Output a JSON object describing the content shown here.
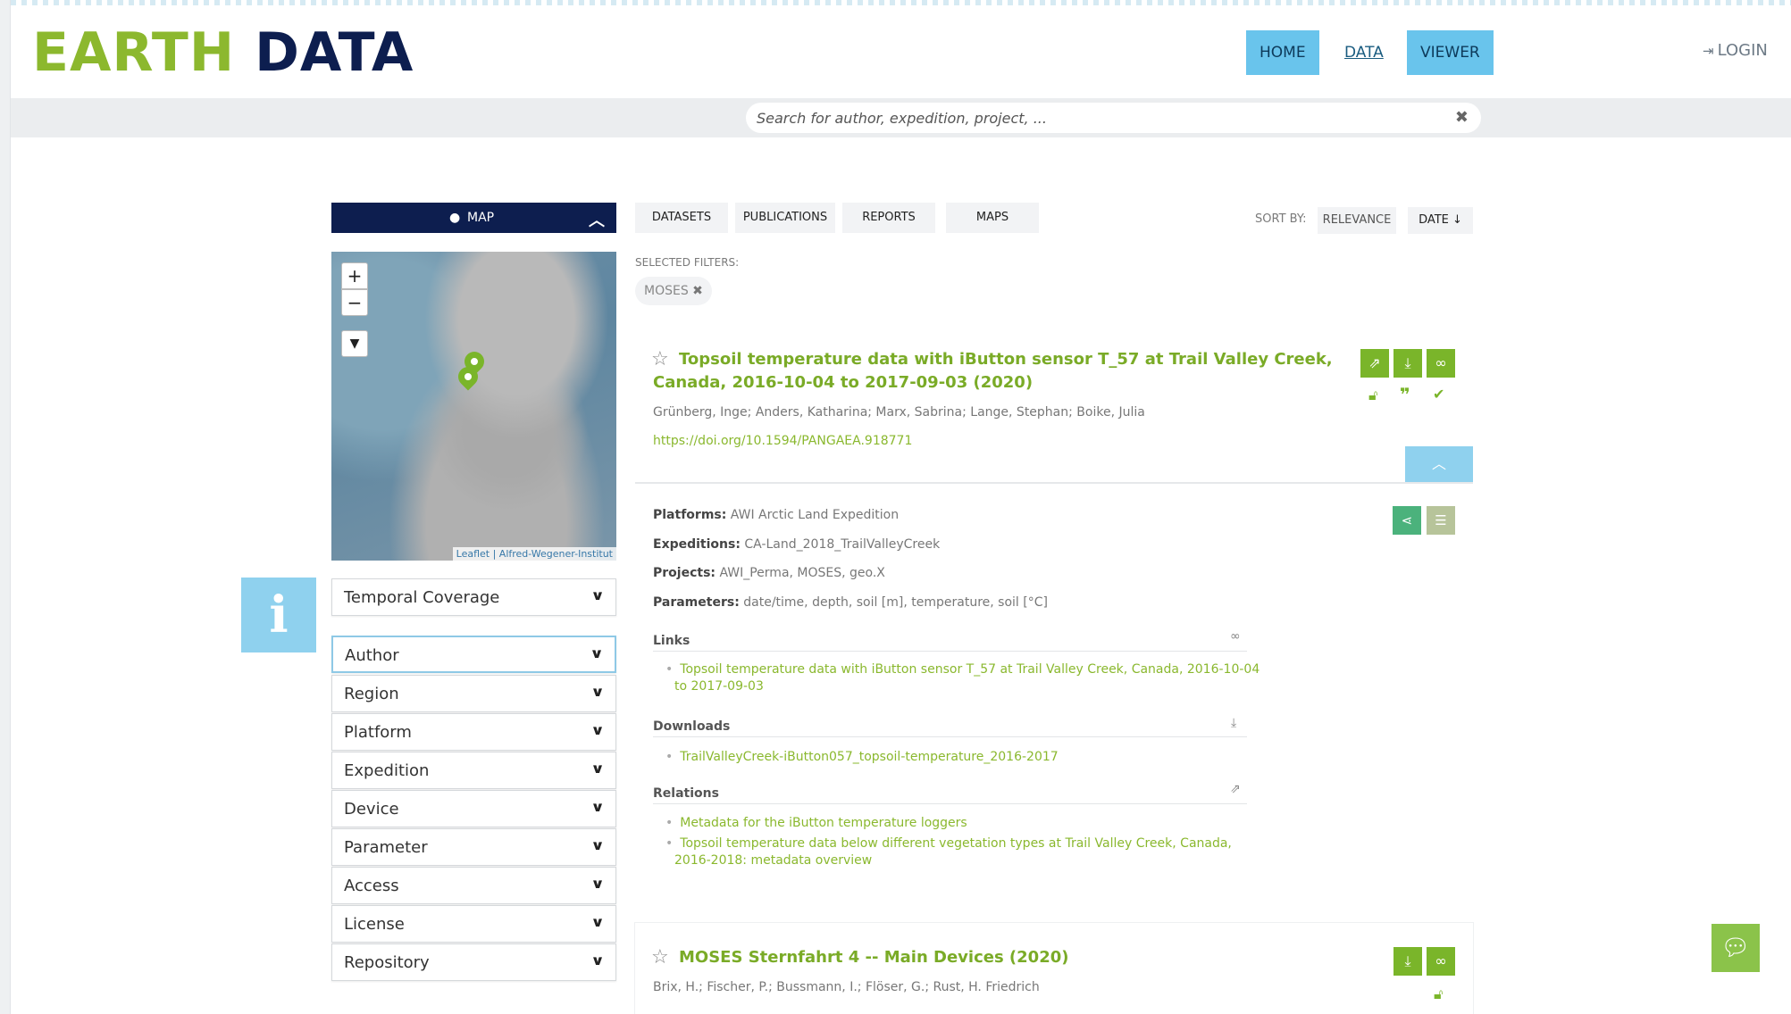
{
  "header": {
    "logo_part1": "EARTH",
    "logo_part2": "DATA",
    "nav": {
      "home": "HOME",
      "data": "DATA",
      "viewer": "VIEWER"
    },
    "login": "LOGIN"
  },
  "search": {
    "placeholder": "Search for author, expedition, project, ..."
  },
  "map_panel": {
    "title": "MAP",
    "attribution": "Leaflet | Alfred-Wegener-Institut"
  },
  "info_box": "i",
  "filters": [
    "Temporal Coverage",
    "Author",
    "Region",
    "Platform",
    "Expedition",
    "Device",
    "Parameter",
    "Access",
    "License",
    "Repository"
  ],
  "tabs": [
    "DATASETS",
    "PUBLICATIONS",
    "REPORTS",
    "MAPS"
  ],
  "sort": {
    "label": "SORT BY:",
    "relevance": "RELEVANCE",
    "date": "DATE"
  },
  "selected_filters": {
    "label": "SELECTED FILTERS:",
    "chips": [
      "MOSES"
    ]
  },
  "results": [
    {
      "title_line1": "Topsoil temperature data with iButton sensor T_57 at Trail Valley Creek,",
      "title_line2": "Canada, 2016-10-04 to 2017-09-03 (2020)",
      "authors": "Grünberg, Inge; Anders, Katharina; Marx, Sabrina; Lange, Stephan; Boike, Julia",
      "doi": "https://doi.org/10.1594/PANGAEA.918771",
      "platforms_label": "Platforms:",
      "platforms": "AWI Arctic Land Expedition",
      "expeditions_label": "Expeditions:",
      "expeditions": "CA-Land_2018_TrailValleyCreek",
      "projects_label": "Projects:",
      "projects": "AWI_Perma, MOSES, geo.X",
      "parameters_label": "Parameters:",
      "parameters": "date/time, depth, soil [m], temperature, soil [°C]",
      "links_header": "Links",
      "links": [
        "Topsoil temperature data with iButton sensor T_57 at Trail Valley Creek, Canada, 2016-10-04",
        "to 2017-09-03"
      ],
      "downloads_header": "Downloads",
      "downloads": [
        "TrailValleyCreek-iButton057_topsoil-temperature_2016-2017"
      ],
      "relations_header": "Relations",
      "relations": [
        "Metadata for the iButton temperature loggers",
        "Topsoil temperature data below different vegetation types at Trail Valley Creek, Canada,",
        "2016-2018: metadata overview"
      ]
    },
    {
      "title": "MOSES Sternfahrt 4 -- Main Devices (2020)",
      "authors": "Brix, H.; Fischer, P.; Bussmann, I.; Flöser, G.; Rust, H. Friedrich"
    }
  ],
  "colors": {
    "brand_green": "#8cb82e",
    "brand_navy": "#0d1e4f",
    "accent_blue": "#69c4ec",
    "action_green": "#7ab52a"
  },
  "icons": {
    "map_pin": "map-pin-icon",
    "chevron_up": "chevron-up-icon",
    "zoom_in": "plus-icon",
    "zoom_out": "minus-icon",
    "filter": "filter-icon",
    "external_link": "external-link-icon",
    "download": "download-icon",
    "link": "link-icon",
    "unlock": "unlock-icon",
    "quote": "quote-icon",
    "check": "check-circle-icon",
    "share": "share-icon",
    "list": "list-icon",
    "chat": "chat-icon",
    "login": "sign-in-icon",
    "close": "close-icon"
  }
}
